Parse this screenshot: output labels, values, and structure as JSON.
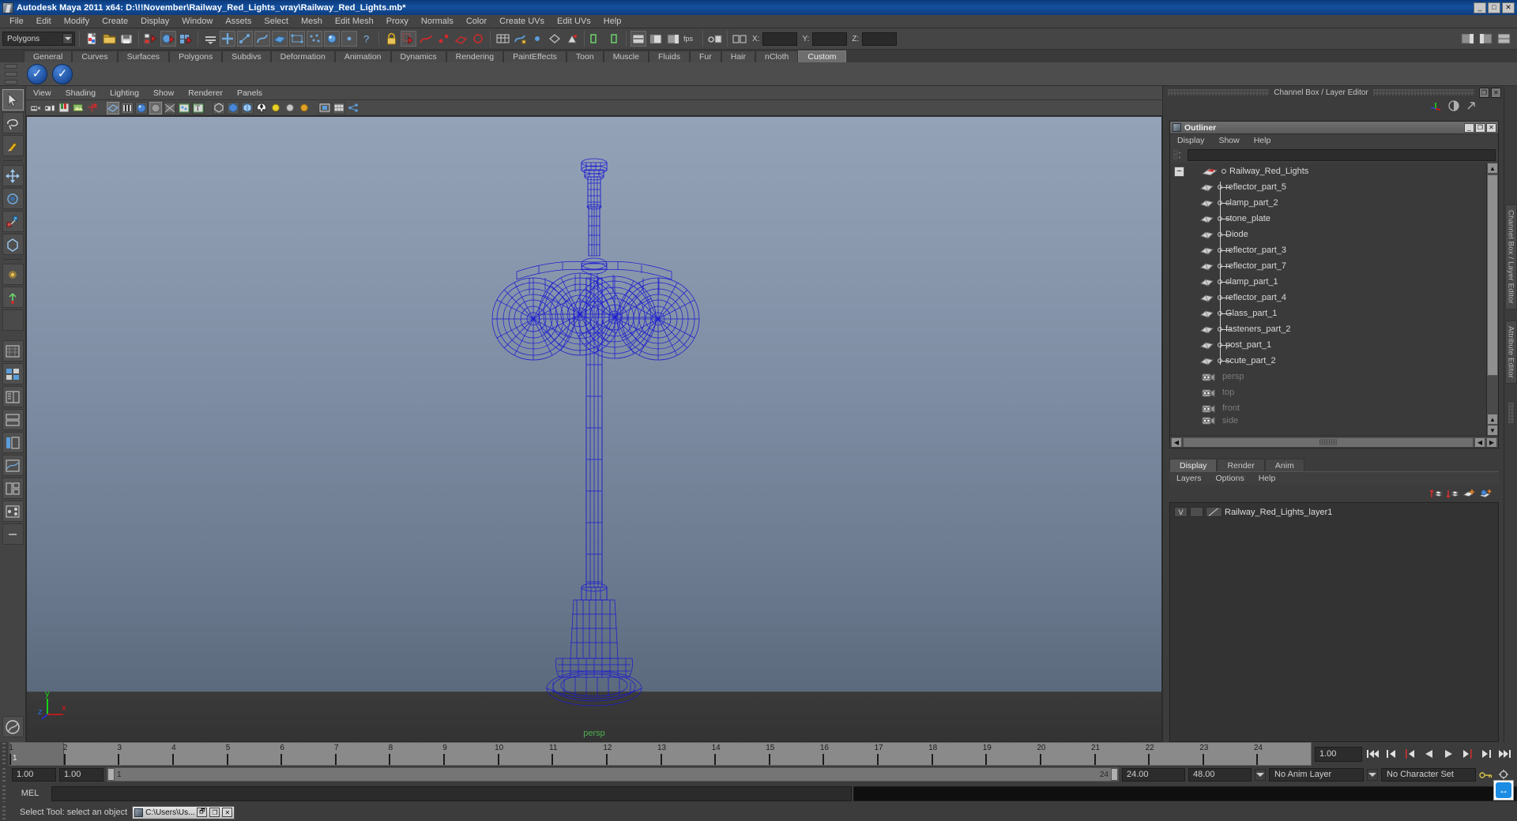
{
  "window": {
    "title": "Autodesk Maya 2011 x64: D:\\!!November\\Railway_Red_Lights_vray\\Railway_Red_Lights.mb*",
    "minimize": "_",
    "maximize": "□",
    "close": "✕"
  },
  "menubar": {
    "items": [
      "File",
      "Edit",
      "Modify",
      "Create",
      "Display",
      "Window",
      "Assets",
      "Select",
      "Mesh",
      "Edit Mesh",
      "Proxy",
      "Normals",
      "Color",
      "Create UVs",
      "Edit UVs",
      "Help"
    ]
  },
  "statusbar": {
    "menu_set": "Polygons",
    "x_label": "X:",
    "y_label": "Y:",
    "z_label": "Z:",
    "x_value": "",
    "y_value": "",
    "z_value": ""
  },
  "shelf": {
    "tabs": [
      "General",
      "Curves",
      "Surfaces",
      "Polygons",
      "Subdivs",
      "Deformation",
      "Animation",
      "Dynamics",
      "Rendering",
      "PaintEffects",
      "Toon",
      "Muscle",
      "Fluids",
      "Fur",
      "Hair",
      "nCloth",
      "Custom"
    ],
    "active_tab": "Custom",
    "buttons": [
      "custom-shelf-item-1",
      "custom-shelf-item-2"
    ]
  },
  "viewport": {
    "panel_menu": [
      "View",
      "Shading",
      "Lighting",
      "Show",
      "Renderer",
      "Panels"
    ],
    "camera_label": "persp",
    "axis": {
      "x": "x",
      "y": "y",
      "z": "z"
    },
    "background_top": "#94a2b7",
    "background_bottom": "#5c6a7d",
    "wireframe_color": "#1a1ad0"
  },
  "channel_box": {
    "title": "Channel Box / Layer Editor",
    "restore": "❐",
    "close": "✕"
  },
  "outliner": {
    "title": "Outliner",
    "menu": [
      "Display",
      "Show",
      "Help"
    ],
    "search_value": "",
    "window_buttons": {
      "minimize": "_",
      "maximize": "❐",
      "close": "✕"
    },
    "root": {
      "label": "Railway_Red_Lights",
      "expander": "−"
    },
    "children": [
      "reflector_part_5",
      "clamp_part_2",
      "stone_plate",
      "Diode",
      "reflector_part_3",
      "reflector_part_7",
      "clamp_part_1",
      "reflector_part_4",
      "Glass_part_1",
      "fasteners_part_2",
      "post_part_1",
      "scute_part_2"
    ],
    "cameras": [
      "persp",
      "top",
      "front",
      "side"
    ]
  },
  "layer_editor": {
    "tabs": [
      "Display",
      "Render",
      "Anim"
    ],
    "active_tab": "Display",
    "menu": [
      "Layers",
      "Options",
      "Help"
    ],
    "layers": [
      {
        "visibility": "V",
        "playback": "",
        "name": "Railway_Red_Lights_layer1"
      }
    ]
  },
  "side_tabs": [
    "Channel Box / Layer Editor",
    "Attribute Editor"
  ],
  "timeline": {
    "ticks": [
      "1",
      "2",
      "3",
      "4",
      "5",
      "6",
      "7",
      "8",
      "9",
      "10",
      "11",
      "12",
      "13",
      "14",
      "15",
      "16",
      "17",
      "18",
      "19",
      "20",
      "21",
      "22",
      "23",
      "24"
    ],
    "current_frame_marker": "1",
    "current_frame_field": "1.00"
  },
  "range": {
    "start": "1.00",
    "end": "1.00",
    "slider_start": "1",
    "slider_end": "24",
    "playback_end": "24.00",
    "anim_end": "48.00",
    "anim_layer": "No Anim Layer",
    "character_set": "No Character Set"
  },
  "command_line": {
    "label": "MEL",
    "value": "",
    "output": ""
  },
  "help_line": {
    "text": "Select Tool: select an object"
  },
  "taskbar": {
    "button_label": "C:\\Users\\Us...",
    "buttons": [
      "🗗",
      "❐",
      "✕"
    ]
  },
  "floating": {
    "name": "teamviewer-button",
    "glyph": "↔"
  }
}
